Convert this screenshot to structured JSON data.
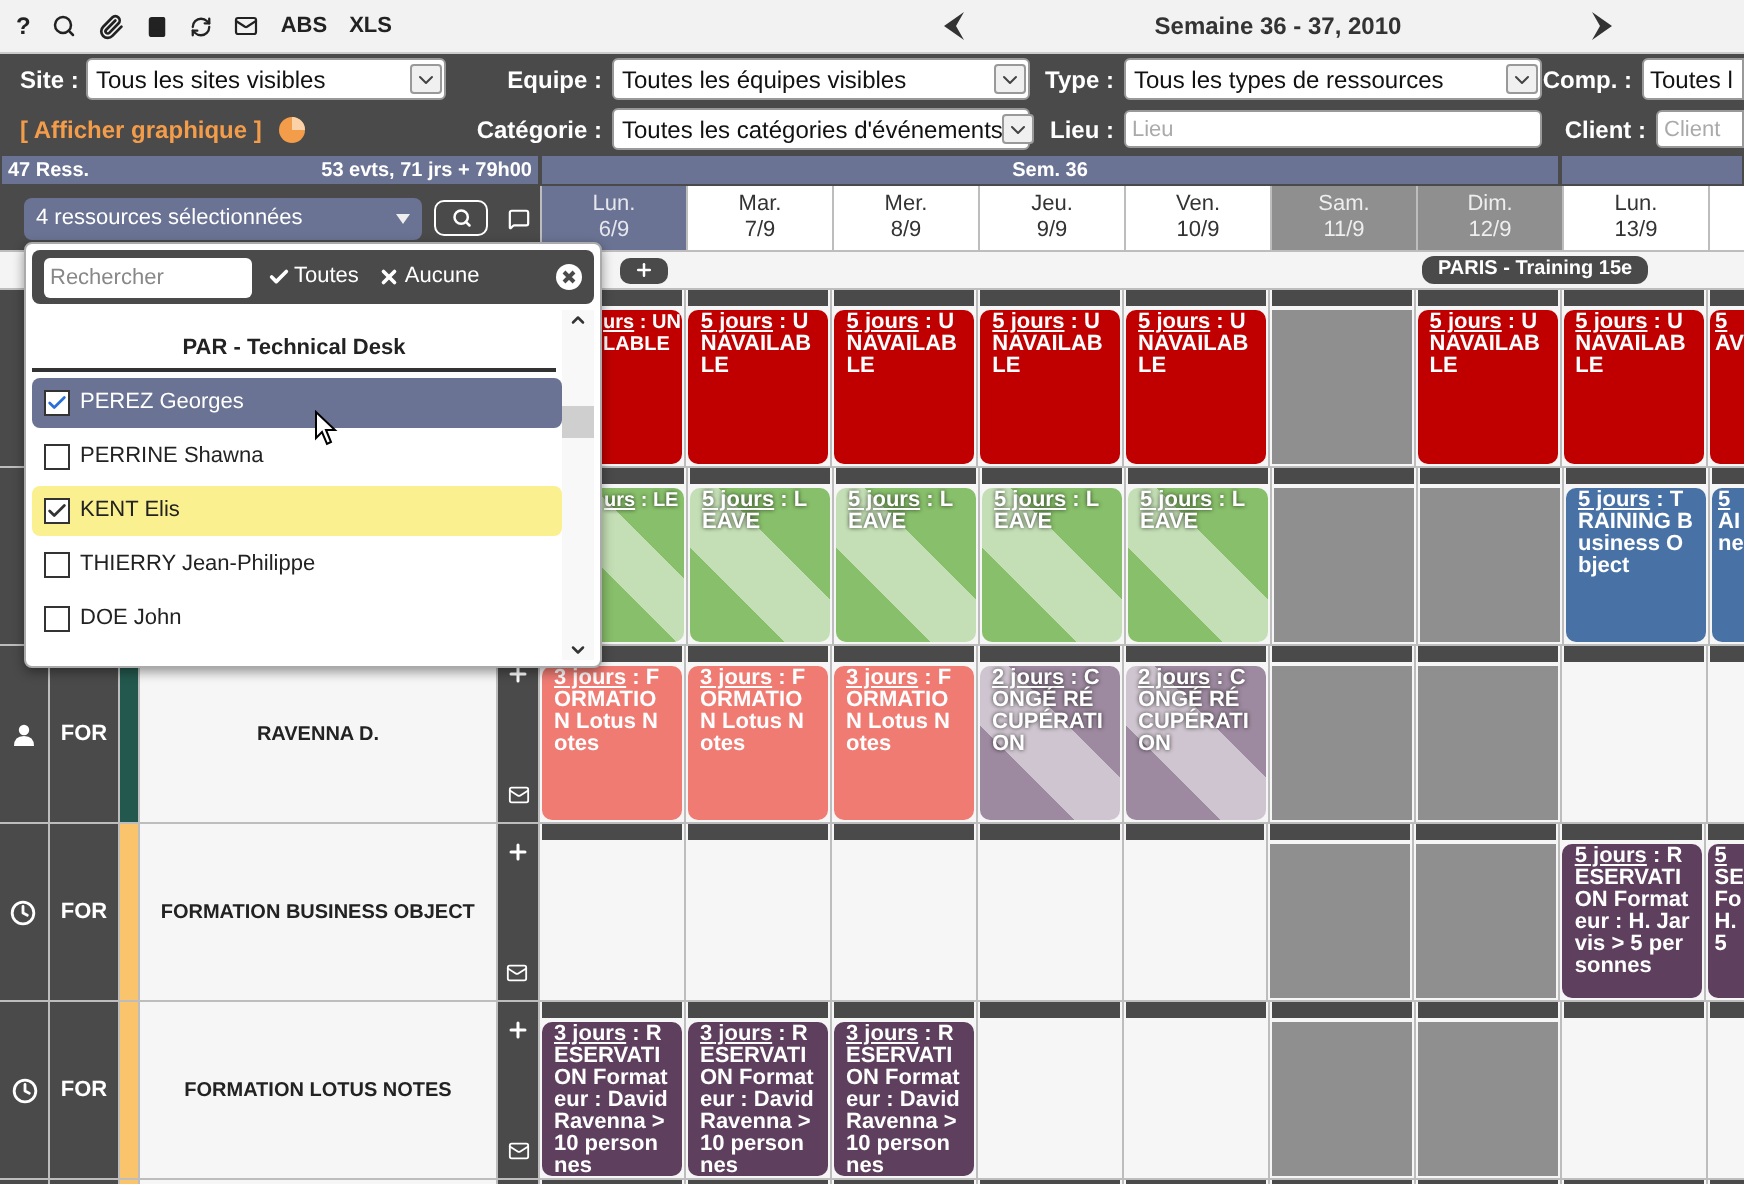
{
  "toolbar": {
    "help": "?",
    "exports": [
      "ABS",
      "XLS"
    ],
    "period": "Semaine 36 - 37, 2010"
  },
  "filters": {
    "site": {
      "label": "Site :",
      "value": "Tous les sites visibles"
    },
    "team": {
      "label": "Equipe :",
      "value": "Toutes les équipes visibles"
    },
    "type": {
      "label": "Type :",
      "value": "Tous les types de ressources"
    },
    "comp": {
      "label": "Comp. :",
      "value": "Toutes l"
    },
    "chart_link": "[ Afficher graphique ]",
    "category": {
      "label": "Catégorie :",
      "value": "Toutes les catégories d'événements"
    },
    "place": {
      "label": "Lieu :",
      "placeholder": "Lieu"
    },
    "client": {
      "label": "Client :",
      "placeholder": "Client"
    }
  },
  "summary": {
    "resources": "47 Ress.",
    "totals": "53 evts, 71 jrs + 79h00"
  },
  "weeks": [
    {
      "label": "Sem. 36"
    }
  ],
  "resource_picker": {
    "value": "4 ressources sélectionnées",
    "search_placeholder": "Rechercher",
    "select_all": "Toutes",
    "select_none": "Aucune",
    "group": "PAR - Technical Desk",
    "items": [
      {
        "label": "PEREZ Georges",
        "checked": true,
        "hovered": true,
        "selected": false
      },
      {
        "label": "PERRINE Shawna",
        "checked": false,
        "hovered": false,
        "selected": false
      },
      {
        "label": "KENT Elis",
        "checked": true,
        "hovered": false,
        "selected": true
      },
      {
        "label": "THIERRY Jean-Philippe",
        "checked": false,
        "hovered": false,
        "selected": false
      },
      {
        "label": "DOE John",
        "checked": false,
        "hovered": false,
        "selected": false
      }
    ]
  },
  "days": [
    {
      "name": "Lun.",
      "date": "6/9",
      "today": true,
      "weekend": false
    },
    {
      "name": "Mar.",
      "date": "7/9",
      "today": false,
      "weekend": false
    },
    {
      "name": "Mer.",
      "date": "8/9",
      "today": false,
      "weekend": false
    },
    {
      "name": "Jeu.",
      "date": "9/9",
      "today": false,
      "weekend": false
    },
    {
      "name": "Ven.",
      "date": "10/9",
      "today": false,
      "weekend": false
    },
    {
      "name": "Sam.",
      "date": "11/9",
      "today": false,
      "weekend": true
    },
    {
      "name": "Dim.",
      "date": "12/9",
      "today": false,
      "weekend": true
    },
    {
      "name": "Lun.",
      "date": "13/9",
      "today": false,
      "weekend": false
    }
  ],
  "banner": "PARIS - Training 15e",
  "rows": [
    {
      "cells": [
        {
          "kind": "covered_event",
          "duration": "urs",
          "text": ": UN",
          "lines": [
            "LABLE"
          ],
          "color": "#c00000",
          "striped": false
        },
        {
          "kind": "event",
          "duration": "5 jours",
          "text": ": UNAVAILABLE",
          "color": "#c00000",
          "striped": false
        },
        {
          "kind": "event",
          "duration": "5 jours",
          "text": ": UNAVAILABLE",
          "color": "#c00000",
          "striped": false
        },
        {
          "kind": "event",
          "duration": "5 jours",
          "text": ": UNAVAILABLE",
          "color": "#c00000",
          "striped": false
        },
        {
          "kind": "event",
          "duration": "5 jours",
          "text": ": UNAVAILABLE",
          "color": "#c00000",
          "striped": false
        },
        {
          "kind": "empty"
        },
        {
          "kind": "event",
          "duration": "5 jours",
          "text": ": UNAVAILABLE",
          "color": "#c00000",
          "striped": false
        },
        {
          "kind": "event",
          "duration": "5 jours",
          "text": ": UNAVAILABLE",
          "color": "#c00000",
          "striped": false
        },
        {
          "kind": "edge_event",
          "duration": "5",
          "lines": [
            "AV"
          ],
          "color": "#c00000",
          "striped": false
        }
      ]
    },
    {
      "cells": [
        {
          "kind": "covered_event",
          "duration": "urs",
          "text": ": LE",
          "color": "#88bf6a",
          "striped": true
        },
        {
          "kind": "event",
          "duration": "5 jours",
          "text": ": LEAVE",
          "color": "#88bf6a",
          "striped": true
        },
        {
          "kind": "event",
          "duration": "5 jours",
          "text": ": LEAVE",
          "color": "#88bf6a",
          "striped": true
        },
        {
          "kind": "event",
          "duration": "5 jours",
          "text": ": LEAVE",
          "color": "#88bf6a",
          "striped": true
        },
        {
          "kind": "event",
          "duration": "5 jours",
          "text": ": LEAVE",
          "color": "#88bf6a",
          "striped": true
        },
        {
          "kind": "empty"
        },
        {
          "kind": "empty"
        },
        {
          "kind": "event",
          "duration": "5 jours",
          "text": ": TRAINING Business Object",
          "color": "#4872a5",
          "striped": false
        },
        {
          "kind": "edge_event",
          "duration": "5",
          "lines": [
            "AI",
            "ne"
          ],
          "color": "#4872a5",
          "striped": false
        }
      ]
    },
    {
      "kind": "person",
      "code": "FOR",
      "color": "#23584e",
      "name": "RAVENNA D.",
      "cells": [
        {
          "kind": "event",
          "duration": "3 jours",
          "text": ": FORMATION Lotus Notes",
          "color": "#ef7b73",
          "striped": false
        },
        {
          "kind": "event",
          "duration": "3 jours",
          "text": ": FORMATION Lotus Notes",
          "color": "#ef7b73",
          "striped": false
        },
        {
          "kind": "event",
          "duration": "3 jours",
          "text": ": FORMATION Lotus Notes",
          "color": "#ef7b73",
          "striped": false
        },
        {
          "kind": "event",
          "duration": "2 jours",
          "text": ": CONGÉ RÉCUPÉRATION",
          "color": "#9e8aa0",
          "striped": true
        },
        {
          "kind": "event",
          "duration": "2 jours",
          "text": ": CONGÉ RÉCUPÉRATION",
          "color": "#9e8aa0",
          "striped": true
        },
        {
          "kind": "empty"
        },
        {
          "kind": "empty"
        },
        {
          "kind": "empty"
        },
        {
          "kind": "empty"
        }
      ]
    },
    {
      "kind": "clock",
      "code": "FOR",
      "color": "#f9c46b",
      "name": "FORMATION BUSINESS OBJECT",
      "cells": [
        {
          "kind": "empty"
        },
        {
          "kind": "empty"
        },
        {
          "kind": "empty"
        },
        {
          "kind": "empty"
        },
        {
          "kind": "empty"
        },
        {
          "kind": "empty"
        },
        {
          "kind": "empty"
        },
        {
          "kind": "event",
          "duration": "5 jours",
          "text": ": RESERVATION Formateur : H. Jarvis > 5 personnes",
          "color": "#5e3f5e",
          "striped": false
        },
        {
          "kind": "edge_event",
          "duration": "5",
          "lines": [
            "SE",
            "Fo",
            "H.",
            "5"
          ],
          "color": "#5e3f5e",
          "striped": false
        }
      ]
    },
    {
      "kind": "clock",
      "code": "FOR",
      "color": "#f9c46b",
      "name": "FORMATION LOTUS NOTES",
      "cells": [
        {
          "kind": "event",
          "duration": "3 jours",
          "text": ": RESERVATION Formateur : David Ravenna > 10 personnes",
          "color": "#5e3f5e",
          "striped": false
        },
        {
          "kind": "event",
          "duration": "3 jours",
          "text": ": RESERVATION Formateur : David Ravenna > 10 personnes",
          "color": "#5e3f5e",
          "striped": false
        },
        {
          "kind": "event",
          "duration": "3 jours",
          "text": ": RESERVATION Formateur : David Ravenna > 10 personnes",
          "color": "#5e3f5e",
          "striped": false
        },
        {
          "kind": "empty"
        },
        {
          "kind": "empty"
        },
        {
          "kind": "empty"
        },
        {
          "kind": "empty"
        },
        {
          "kind": "empty"
        },
        {
          "kind": "empty"
        }
      ]
    },
    {
      "color": "#f9c46b",
      "cells": [
        {
          "kind": "strip_only"
        },
        {
          "kind": "strip_only"
        },
        {
          "kind": "strip_only"
        },
        {
          "kind": "strip_only"
        },
        {
          "kind": "strip_only"
        },
        {
          "kind": "strip_only"
        },
        {
          "kind": "strip_only"
        },
        {
          "kind": "strip_only"
        },
        {
          "kind": "strip_only"
        }
      ]
    }
  ]
}
